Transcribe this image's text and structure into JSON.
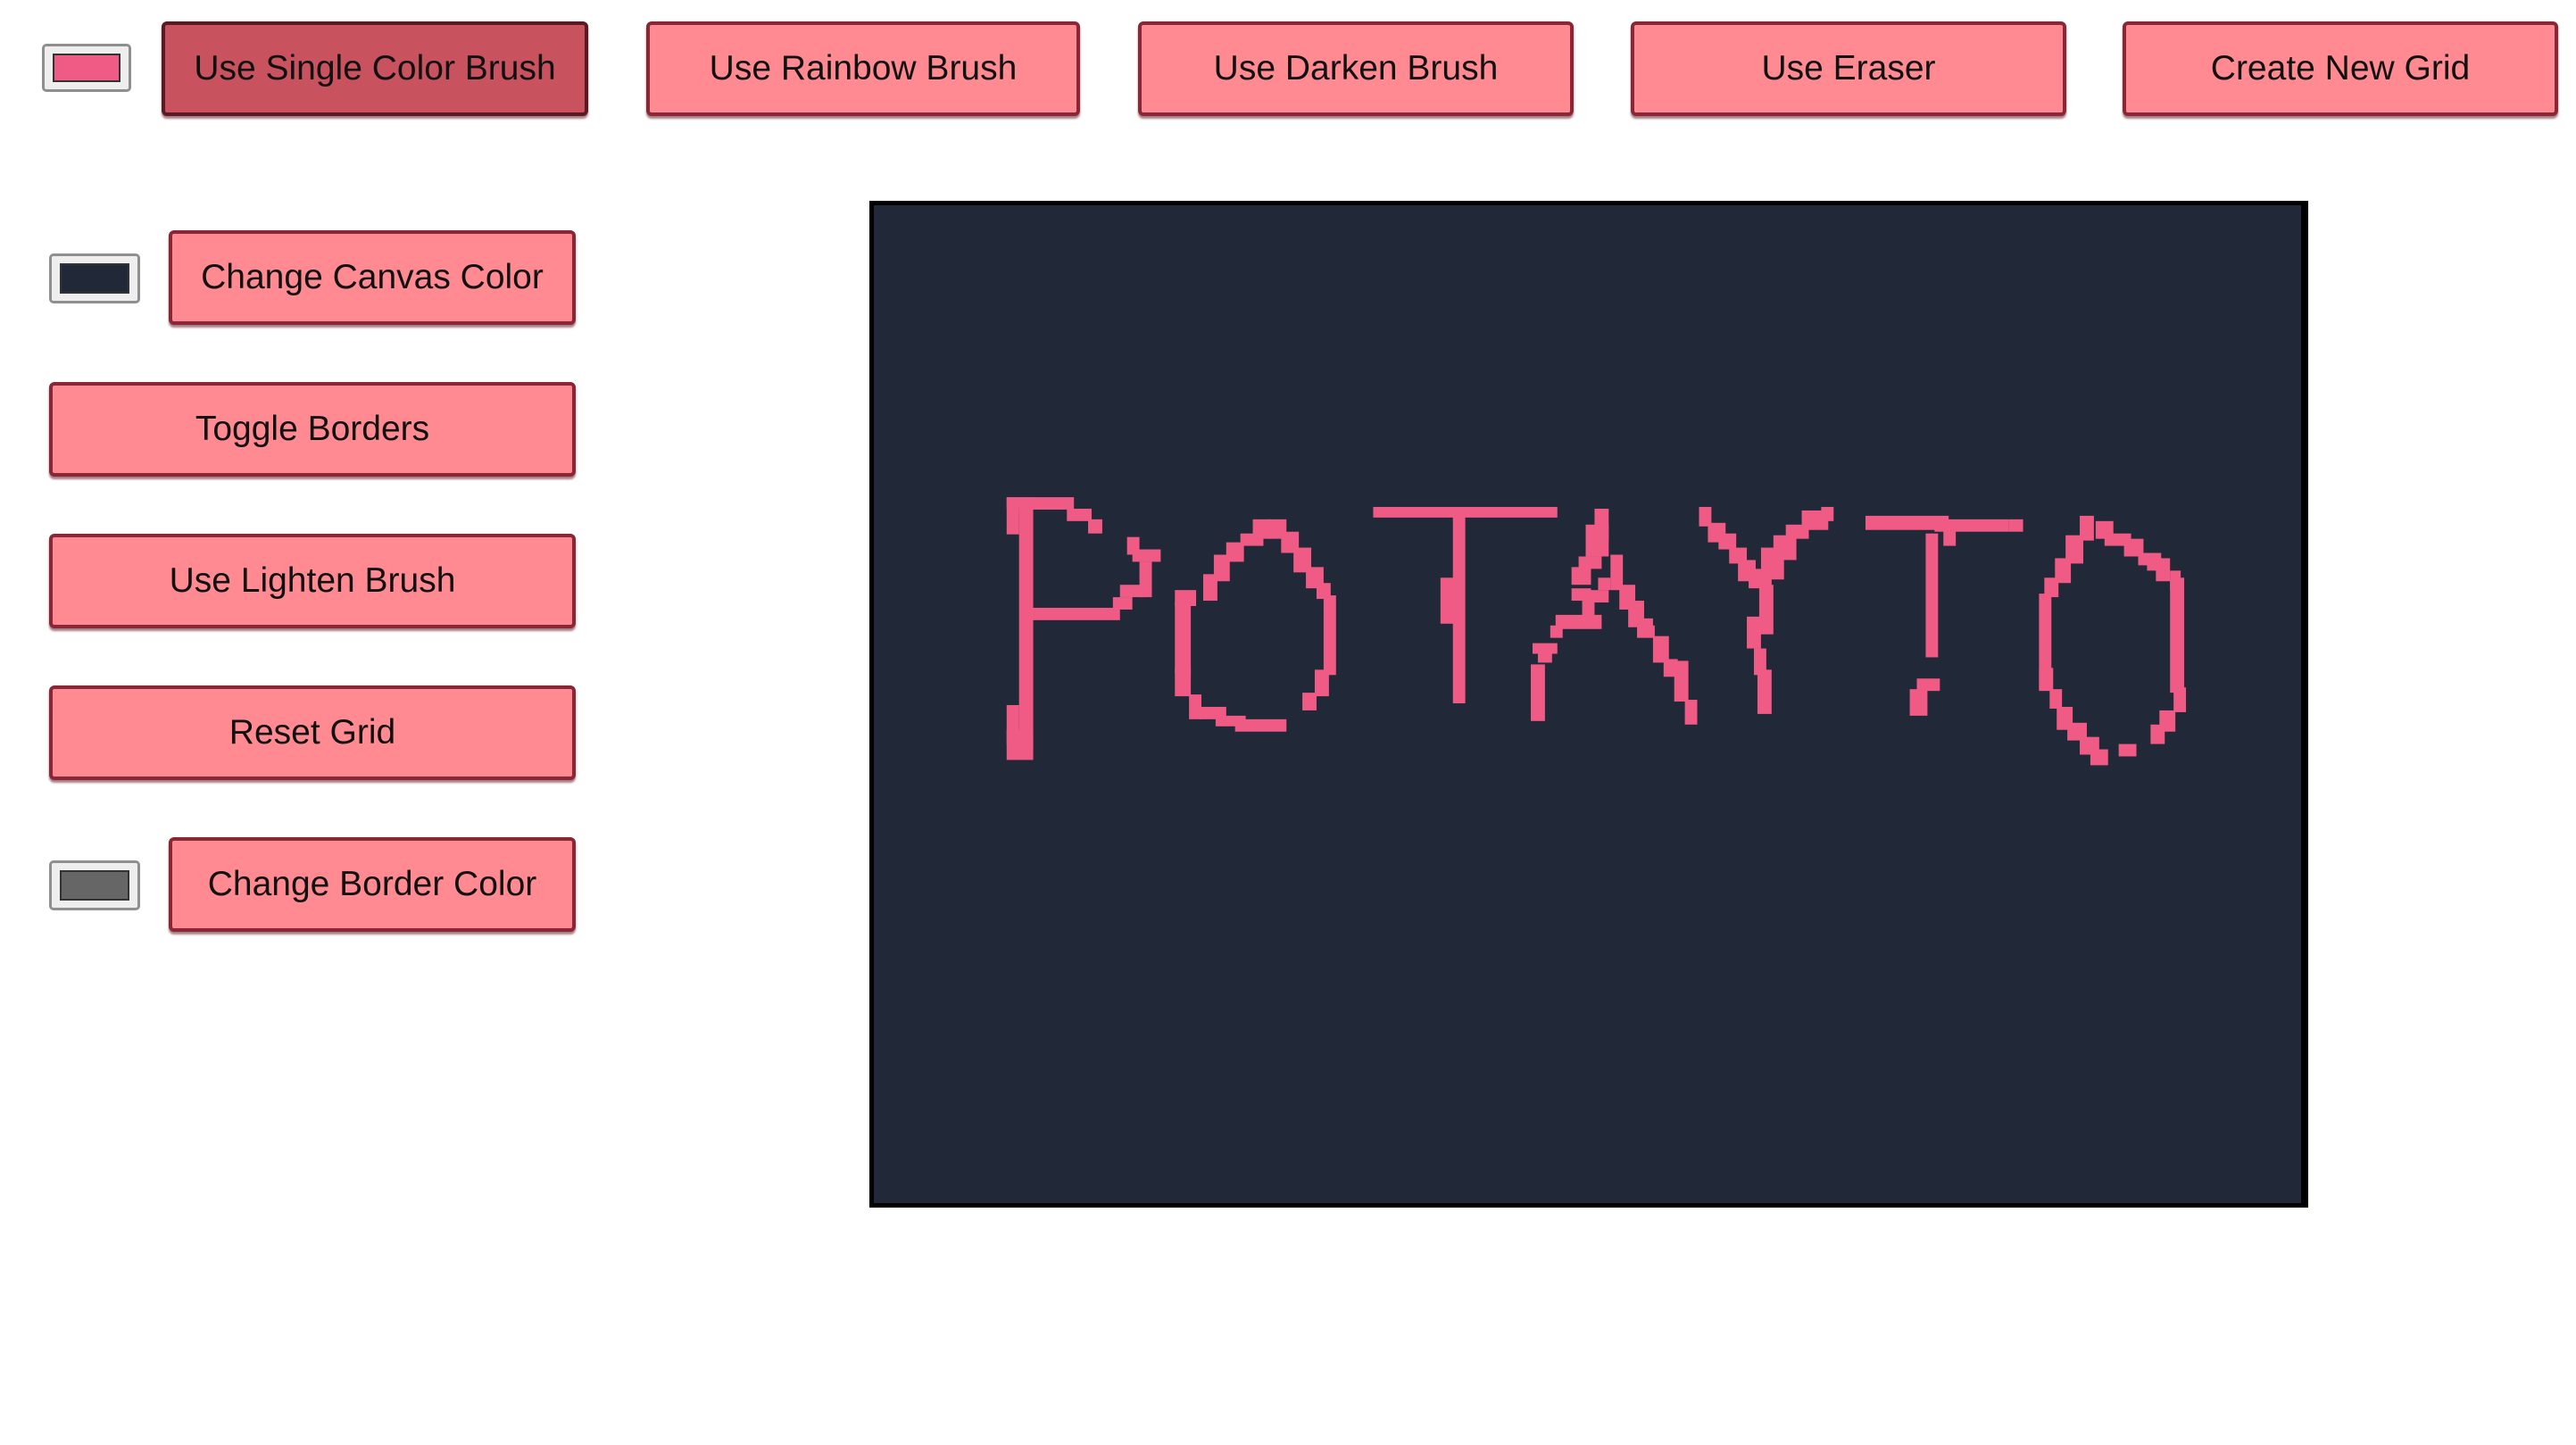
{
  "toolbar": {
    "brush_color": "#ef5b85",
    "buttons": [
      {
        "label": "Use Single Color Brush",
        "active": true
      },
      {
        "label": "Use Rainbow Brush",
        "active": false
      },
      {
        "label": "Use Darken Brush",
        "active": false
      },
      {
        "label": "Use Eraser",
        "active": false
      },
      {
        "label": "Create New Grid",
        "active": false
      }
    ]
  },
  "sidebar": {
    "canvas_color": "#212938",
    "change_canvas_color_label": "Change Canvas Color",
    "toggle_borders_label": "Toggle Borders",
    "lighten_brush_label": "Use Lighten Brush",
    "reset_grid_label": "Reset Grid",
    "border_color": "#666666",
    "change_border_color_label": "Change Border Color"
  },
  "canvas": {
    "background_color": "#212938",
    "paint_color": "#ef5b85",
    "drawn_text": "POTAYTO"
  }
}
